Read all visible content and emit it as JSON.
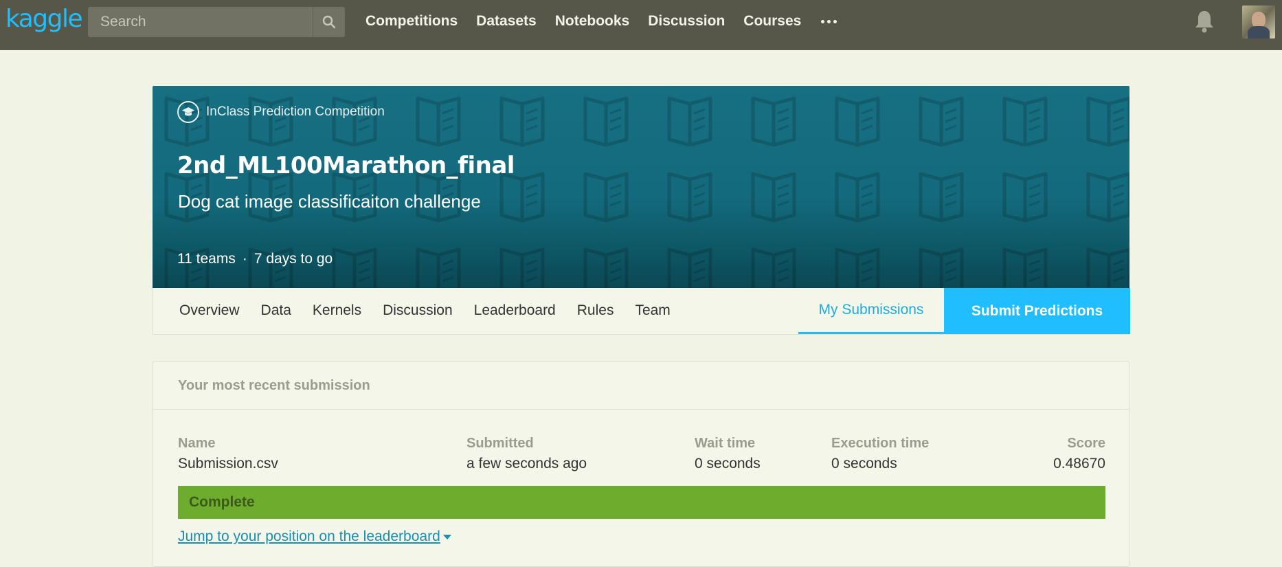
{
  "topnav": {
    "logo": "kaggle",
    "search_placeholder": "Search",
    "links": [
      "Competitions",
      "Datasets",
      "Notebooks",
      "Discussion",
      "Courses"
    ]
  },
  "hero": {
    "competition_type": "InClass Prediction Competition",
    "title": "2nd_ML100Marathon_final",
    "subtitle": "Dog cat image classificaiton challenge",
    "teams": "11 teams",
    "separator": "·",
    "time_left": "7 days to go"
  },
  "tabs": [
    "Overview",
    "Data",
    "Kernels",
    "Discussion",
    "Leaderboard",
    "Rules",
    "Team"
  ],
  "my_submissions": "My Submissions",
  "submit_predictions": "Submit Predictions",
  "submission": {
    "heading": "Your most recent submission",
    "columns": {
      "name": {
        "label": "Name",
        "value": "Submission.csv"
      },
      "submitted": {
        "label": "Submitted",
        "value": "a few seconds ago"
      },
      "wait": {
        "label": "Wait time",
        "value": "0 seconds"
      },
      "execution": {
        "label": "Execution time",
        "value": "0 seconds"
      },
      "score": {
        "label": "Score",
        "value": "0.48670"
      }
    },
    "status": "Complete",
    "jump_link": "Jump to your position on the leaderboard"
  },
  "colors": {
    "nav_bg": "#575749",
    "accent": "#20beff",
    "hero": "#176f82",
    "status_green": "#6eac2e",
    "page_bg": "#f1f3e5"
  },
  "icons": [
    "search-icon",
    "more-icon",
    "bell-icon",
    "graduation-cap-icon",
    "caret-down-icon"
  ]
}
